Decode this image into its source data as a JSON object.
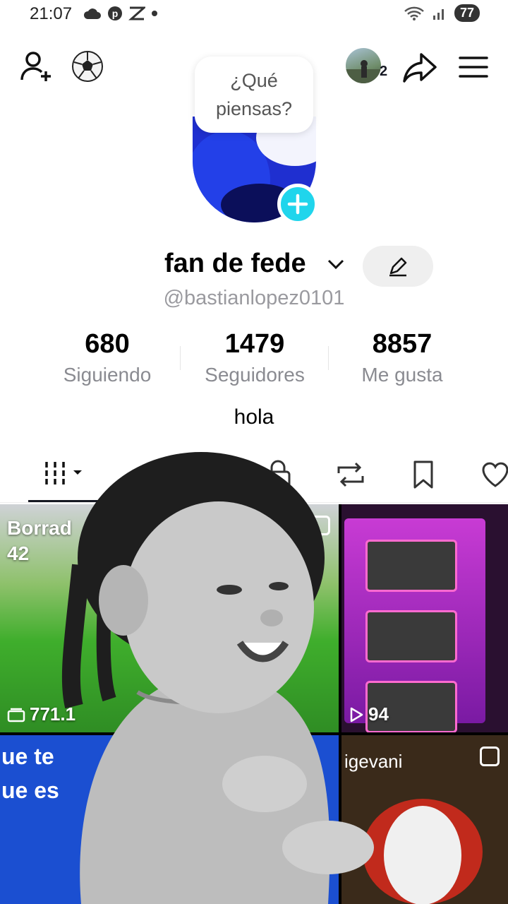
{
  "status_bar": {
    "time": "21:07",
    "battery": "77"
  },
  "top_bar": {
    "followers_badge_count": "2"
  },
  "bubble": {
    "text": "¿Qué piensas?"
  },
  "profile": {
    "name": "fan de fede",
    "handle": "@bastianlopez0101",
    "bio": "hola"
  },
  "stats": [
    {
      "value": "680",
      "label": "Siguiendo"
    },
    {
      "value": "1479",
      "label": "Seguidores"
    },
    {
      "value": "8857",
      "label": "Me gusta"
    }
  ],
  "tabs": [
    {
      "icon": "grid-icon",
      "active": true
    },
    {
      "icon": "lock-icon",
      "active": false
    },
    {
      "icon": "repost-icon",
      "active": false
    },
    {
      "icon": "bookmark-icon",
      "active": false
    },
    {
      "icon": "heart-icon",
      "active": false
    }
  ],
  "grid": [
    {
      "title_line1": "Borrad",
      "title_line2": "42",
      "views": "771.1"
    },
    {
      "views": "94"
    },
    {
      "text_line1": "ue te",
      "text_line2": "ue es"
    },
    {
      "text": "igevani"
    }
  ],
  "colors": {
    "accent": "#20d5ec",
    "text": "#161823",
    "muted": "#8a8b91"
  }
}
